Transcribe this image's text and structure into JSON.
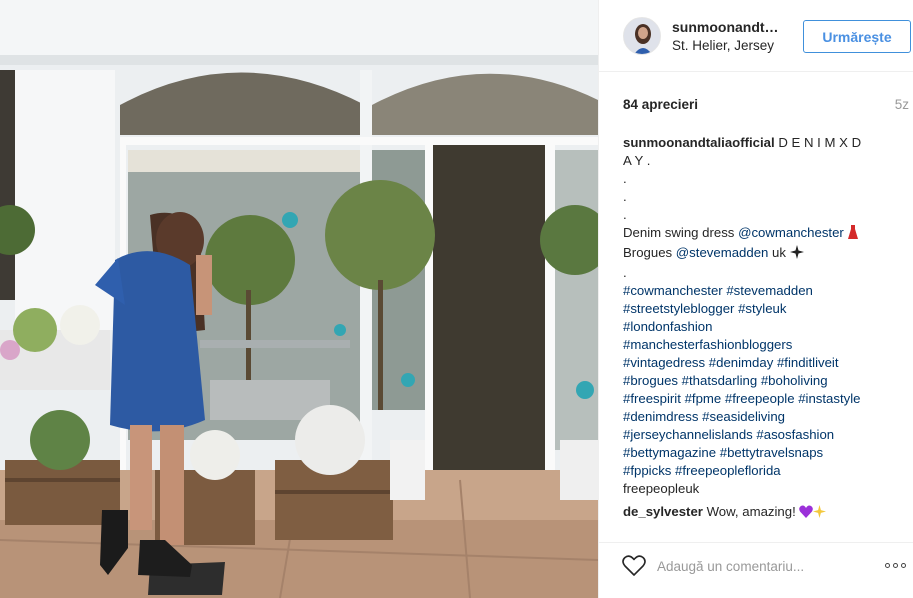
{
  "post": {
    "username": "sunmoonandt…",
    "location": "St. Helier, Jersey",
    "follow_label": "Urmărește",
    "likes": "84 aprecieri",
    "age": "5z"
  },
  "caption": {
    "username": "sunmoonandtaliaofficial",
    "text_line1": "D E N I M X D",
    "text_line2": "A Y .",
    "dots": [
      ".",
      ".",
      "."
    ],
    "dress_prefix": "Denim swing dress ",
    "dress_mention": "@cowmanchester",
    "brogues_prefix": "Brogues ",
    "brogues_mention": "@stevemadden",
    "brogues_suffix": "  uk",
    "dot_after": ".",
    "hashtag_lines": [
      "#cowmanchester #stevemadden",
      "#streetstyleblogger #styleuk",
      "#londonfashion",
      "#manchesterfashionbloggers",
      "#vintagedress #denimday #finditliveit",
      "#brogues #thatsdarling #boholiving",
      "#freespirit #fpme #freepeople #instastyle",
      "#denimdress #seasideliving",
      "#jerseychannelislands #asosfashion",
      "#bettymagazine #bettytravelsnaps",
      "#fppicks #freepeopleflorida"
    ],
    "last_word": "freepeopleuk"
  },
  "comments": [
    {
      "username": "de_sylvester",
      "text": "Wow, amazing!"
    }
  ],
  "comment_box": {
    "placeholder": "Adaugă un comentariu..."
  },
  "icons": {
    "like": "heart-outline-icon",
    "more": "more-options-icon",
    "dress": "red-dress-emoji",
    "sparkle": "sparkles-emoji",
    "purple_heart": "purple-heart-emoji"
  },
  "colors": {
    "follow_blue": "#4a90e2",
    "link_blue": "#003569",
    "muted_gray": "#999999"
  }
}
